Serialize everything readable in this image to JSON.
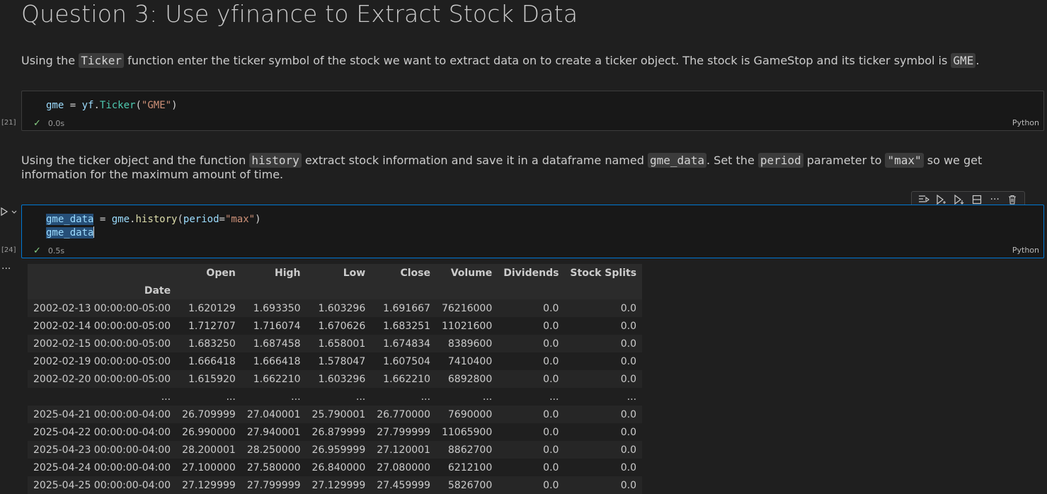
{
  "heading": "Question 3: Use yfinance to Extract Stock Data",
  "md1": {
    "t1": "Using the ",
    "c1": "Ticker",
    "t2": " function enter the ticker symbol of the stock we want to extract data on to create a ticker object. The stock is GameStop and its ticker symbol is ",
    "c2": "GME",
    "t3": "."
  },
  "cell1": {
    "exec": "[21]",
    "code": {
      "var": "gme",
      "eq": " = ",
      "mod": "yf",
      "dot": ".",
      "fn": "Ticker",
      "open": "(",
      "arg": "\"GME\"",
      "close": ")"
    },
    "time": "0.0s",
    "lang": "Python"
  },
  "md2": {
    "t1": "Using the ticker object and the function ",
    "c1": "history",
    "t2": " extract stock information and save it in a dataframe named ",
    "c2": "gme_data",
    "t3": ". Set the ",
    "c3": "period",
    "t4": " parameter to ",
    "c4": "\"max\"",
    "t5": " so we get information for the maximum amount of time."
  },
  "cell2": {
    "exec": "[24]",
    "line1": {
      "var": "gme_data",
      "eq": " = ",
      "obj": "gme",
      "dot": ".",
      "fn": "history",
      "open": "(",
      "param": "period",
      "peq": "=",
      "arg": "\"max\"",
      "close": ")"
    },
    "line2": "gme_data",
    "time": "0.5s",
    "lang": "Python"
  },
  "table": {
    "columns": [
      "Open",
      "High",
      "Low",
      "Close",
      "Volume",
      "Dividends",
      "Stock Splits"
    ],
    "index_name": "Date",
    "rows": [
      [
        "2002-02-13 00:00:00-05:00",
        "1.620129",
        "1.693350",
        "1.603296",
        "1.691667",
        "76216000",
        "0.0",
        "0.0"
      ],
      [
        "2002-02-14 00:00:00-05:00",
        "1.712707",
        "1.716074",
        "1.670626",
        "1.683251",
        "11021600",
        "0.0",
        "0.0"
      ],
      [
        "2002-02-15 00:00:00-05:00",
        "1.683250",
        "1.687458",
        "1.658001",
        "1.674834",
        "8389600",
        "0.0",
        "0.0"
      ],
      [
        "2002-02-19 00:00:00-05:00",
        "1.666418",
        "1.666418",
        "1.578047",
        "1.607504",
        "7410400",
        "0.0",
        "0.0"
      ],
      [
        "2002-02-20 00:00:00-05:00",
        "1.615920",
        "1.662210",
        "1.603296",
        "1.662210",
        "6892800",
        "0.0",
        "0.0"
      ],
      [
        "...",
        "...",
        "...",
        "...",
        "...",
        "...",
        "...",
        "..."
      ],
      [
        "2025-04-21 00:00:00-04:00",
        "26.709999",
        "27.040001",
        "25.790001",
        "26.770000",
        "7690000",
        "0.0",
        "0.0"
      ],
      [
        "2025-04-22 00:00:00-04:00",
        "26.990000",
        "27.940001",
        "26.879999",
        "27.799999",
        "11065900",
        "0.0",
        "0.0"
      ],
      [
        "2025-04-23 00:00:00-04:00",
        "28.200001",
        "28.250000",
        "26.959999",
        "27.120001",
        "8862700",
        "0.0",
        "0.0"
      ],
      [
        "2025-04-24 00:00:00-04:00",
        "27.100000",
        "27.580000",
        "26.840000",
        "27.080000",
        "6212100",
        "0.0",
        "0.0"
      ],
      [
        "2025-04-25 00:00:00-04:00",
        "27.129999",
        "27.799999",
        "27.129999",
        "27.459999",
        "5826700",
        "0.0",
        "0.0"
      ]
    ]
  },
  "toolbar_icons": [
    "execute-above-icon",
    "run-below-icon",
    "run-cell-down-icon",
    "split-cell-icon",
    "more-icon",
    "delete-icon"
  ],
  "colors": {
    "accent": "#0078d4",
    "check": "#89d185",
    "background": "#1f1f1f"
  }
}
